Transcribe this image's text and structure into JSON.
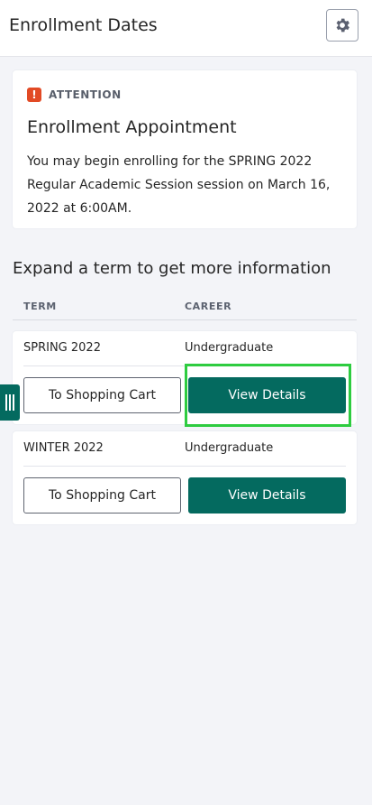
{
  "header": {
    "title": "Enrollment Dates"
  },
  "attention": {
    "label": "ATTENTION",
    "icon_text": "!",
    "heading": "Enrollment Appointment",
    "body": "You may begin enrolling for the SPRING 2022 Regular Academic Session session on March 16, 2022 at 6:00AM."
  },
  "terms_section": {
    "title": "Expand a term to get more information",
    "columns": {
      "term": "TERM",
      "career": "CAREER"
    },
    "rows": [
      {
        "term": "SPRING 2022",
        "career": "Undergraduate",
        "cart_label": "To Shopping Cart",
        "details_label": "View Details"
      },
      {
        "term": "WINTER 2022",
        "career": "Undergraduate",
        "cart_label": "To Shopping Cart",
        "details_label": "View Details"
      }
    ]
  },
  "colors": {
    "primary": "#046a5f",
    "alert": "#e24a25",
    "highlight": "#2ecc40",
    "background": "#f3f4f8"
  },
  "icons": [
    "gear-icon",
    "exclamation-icon",
    "drag-handle-icon"
  ]
}
